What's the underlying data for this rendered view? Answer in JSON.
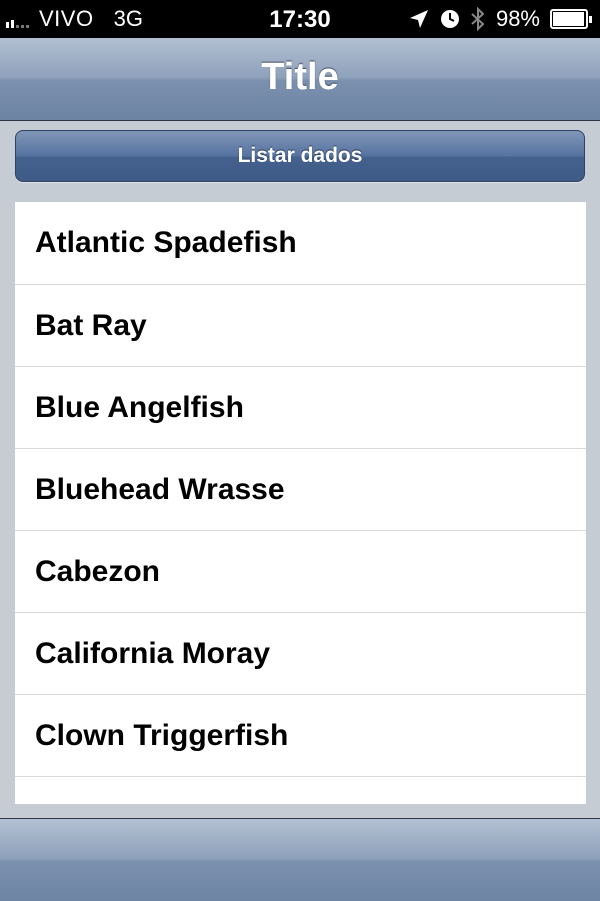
{
  "status_bar": {
    "carrier": "VIVO",
    "network": "3G",
    "time": "17:30",
    "battery_percent": "98%",
    "battery_level": 0.98,
    "icons": [
      "location-arrow-icon",
      "alarm-clock-icon",
      "bluetooth-icon",
      "battery-icon"
    ]
  },
  "nav_bar": {
    "title": "Title"
  },
  "toolbar": {
    "list_button_label": "Listar dados"
  },
  "list": {
    "items": [
      "Atlantic Spadefish",
      "Bat Ray",
      "Blue Angelfish",
      "Bluehead Wrasse",
      "Cabezon",
      "California Moray",
      "Clown Triggerfish",
      ""
    ]
  },
  "colors": {
    "nav_bar": "#8ea1bb",
    "button": "#4f6a96",
    "background": "#c5ccd4"
  }
}
